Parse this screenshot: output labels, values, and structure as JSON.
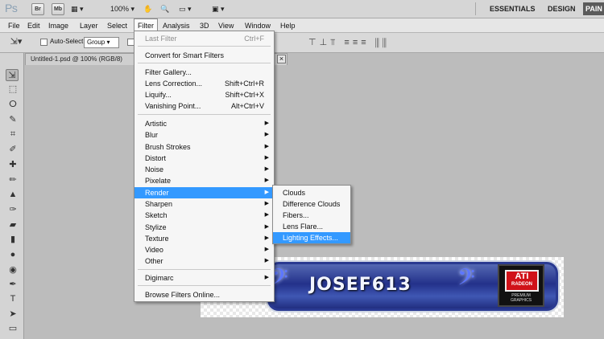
{
  "app": {
    "logo": "Ps",
    "buttons": [
      "Br",
      "Mb"
    ],
    "zoom": "100%",
    "workspaces": [
      "ESSENTIALS",
      "DESIGN",
      "PAIN"
    ]
  },
  "menubar": [
    "File",
    "Edit",
    "Image",
    "Layer",
    "Select",
    "Filter",
    "Analysis",
    "3D",
    "View",
    "Window",
    "Help"
  ],
  "options": {
    "auto_select_label": "Auto-Select:",
    "group_value": "Group"
  },
  "document": {
    "tab_title": "Untitled-1.psd @ 100% (RGB/8)",
    "close_glyph": "×"
  },
  "filter_menu": {
    "last_filter": {
      "label": "Last Filter",
      "shortcut": "Ctrl+F"
    },
    "convert": "Convert for Smart Filters",
    "items_a": [
      {
        "label": "Filter Gallery...",
        "shortcut": ""
      },
      {
        "label": "Lens Correction...",
        "shortcut": "Shift+Ctrl+R"
      },
      {
        "label": "Liquify...",
        "shortcut": "Shift+Ctrl+X"
      },
      {
        "label": "Vanishing Point...",
        "shortcut": "Alt+Ctrl+V"
      }
    ],
    "submenus": [
      "Artistic",
      "Blur",
      "Brush Strokes",
      "Distort",
      "Noise",
      "Pixelate",
      "Render",
      "Sharpen",
      "Sketch",
      "Stylize",
      "Texture",
      "Video",
      "Other"
    ],
    "digimarc": "Digimarc",
    "browse": "Browse Filters Online..."
  },
  "render_submenu": [
    "Clouds",
    "Difference Clouds",
    "Fibers...",
    "Lens Flare...",
    "Lighting Effects..."
  ],
  "banner": {
    "text": "JOSEF613",
    "logo_main": "ATI",
    "logo_sub": "RADEON",
    "logo_tag1": "PREMIUM",
    "logo_tag2": "GRAPHICS"
  },
  "colors": {
    "highlight": "#3399ff",
    "banner_blue": "#23318a",
    "ati_red": "#d01219"
  }
}
